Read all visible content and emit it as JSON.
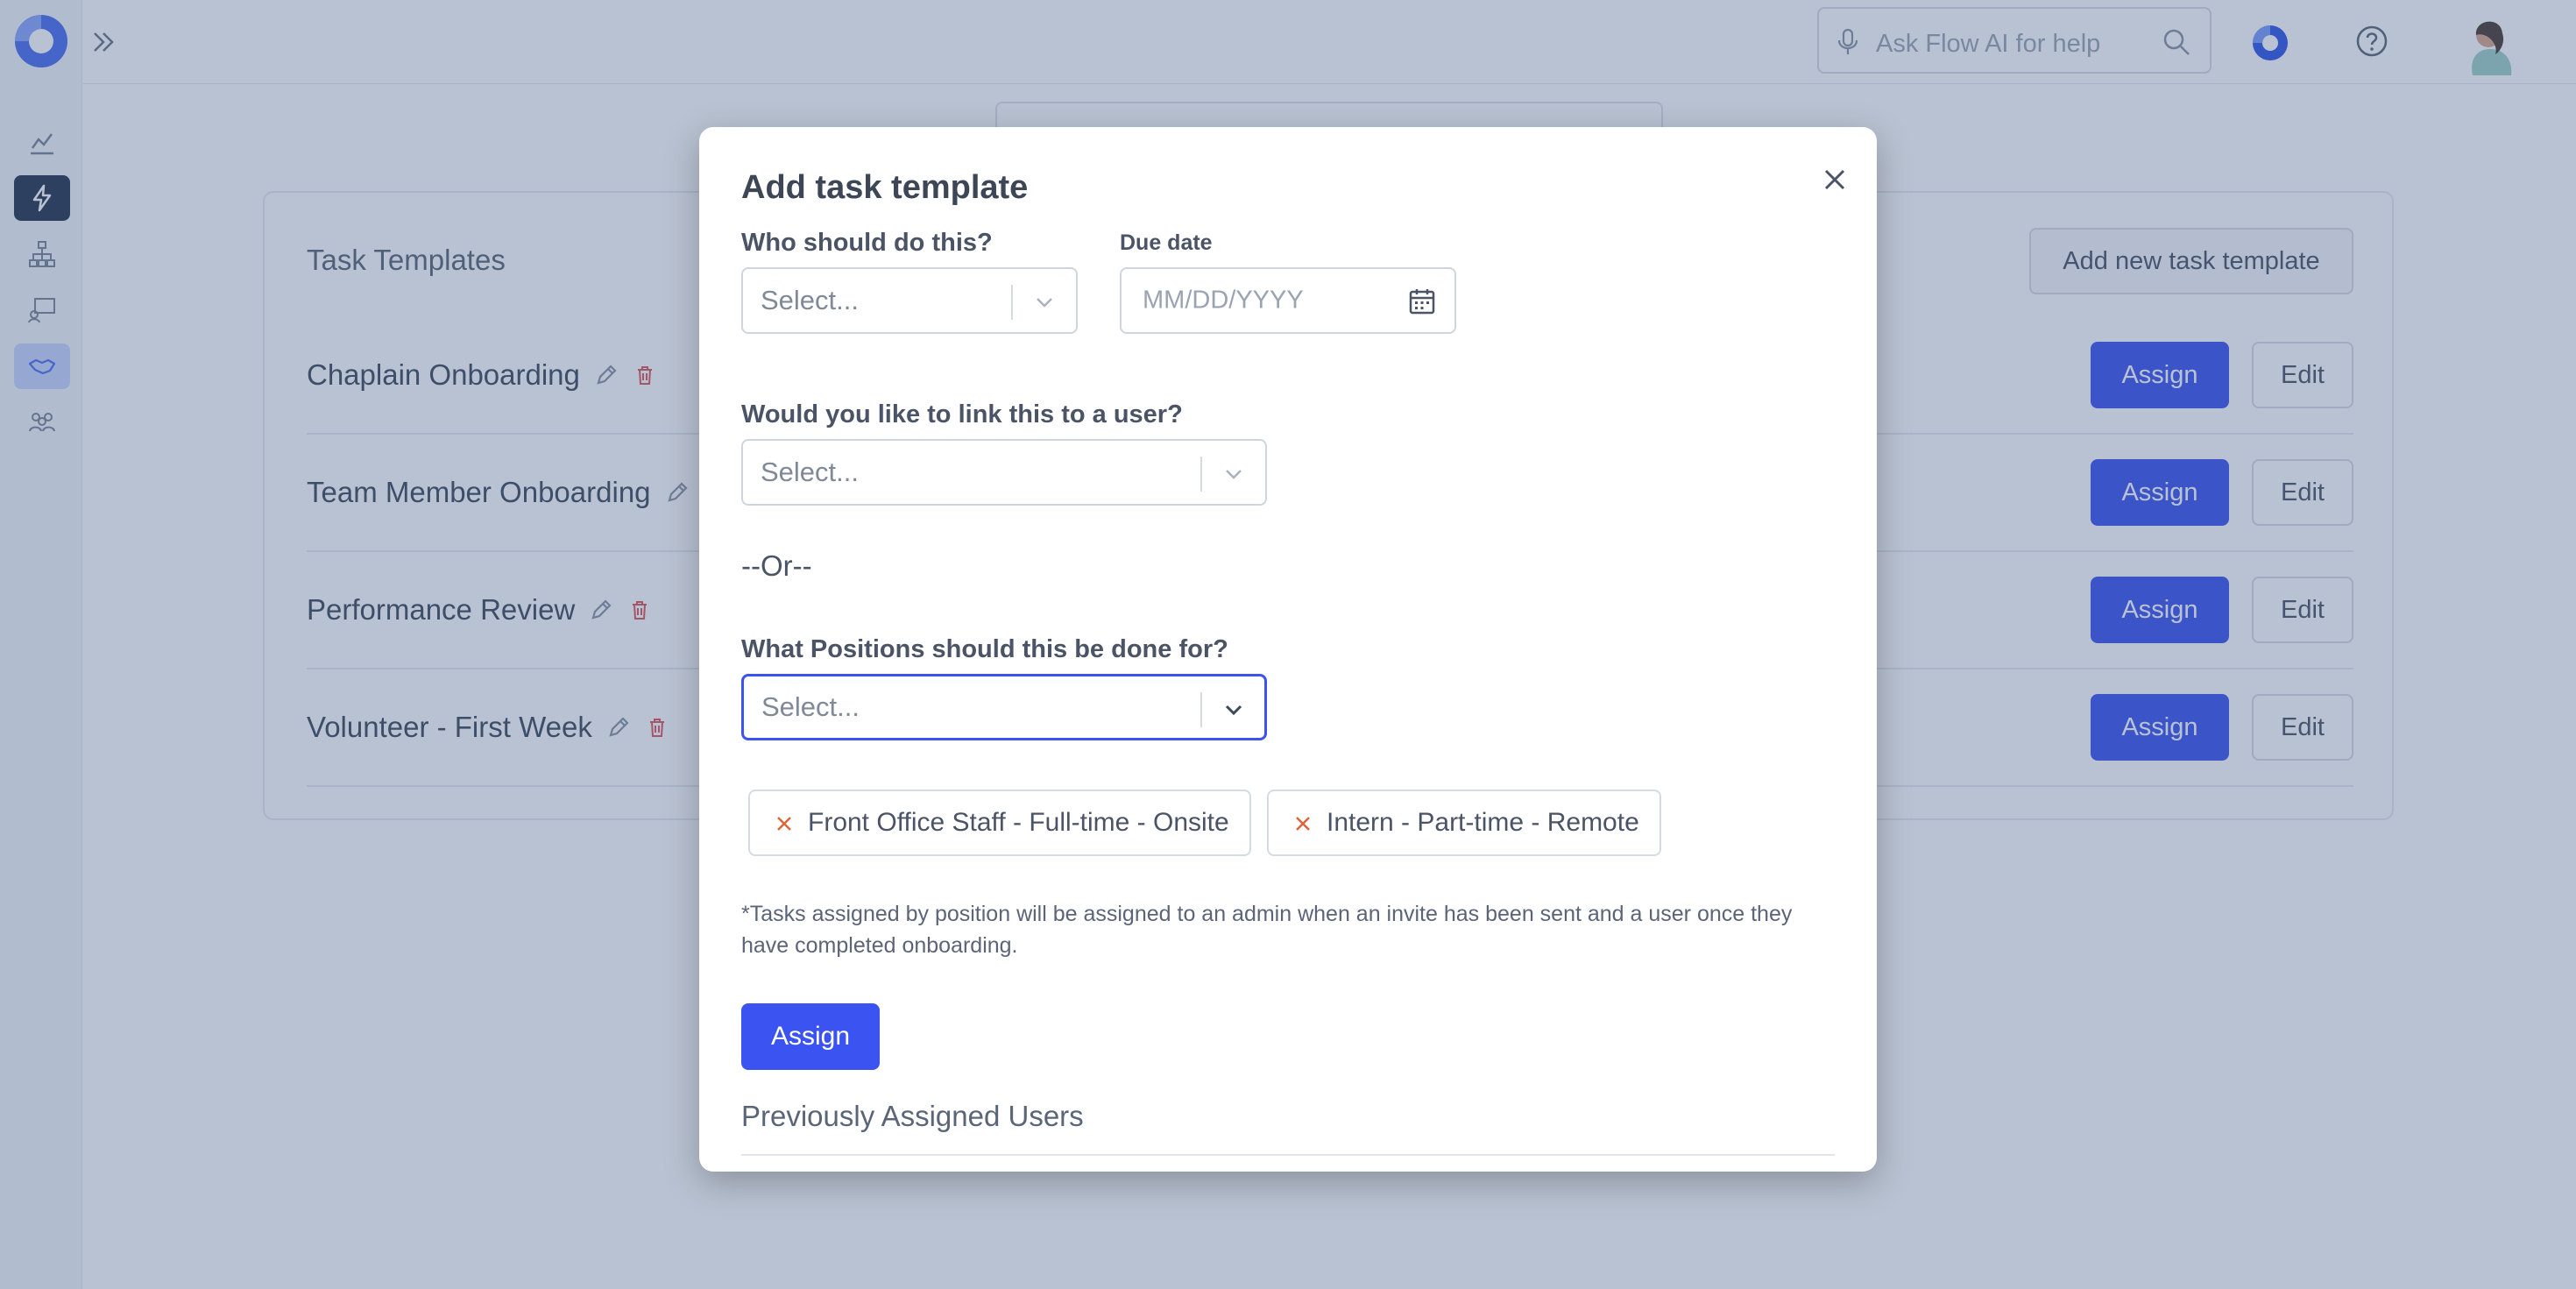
{
  "topbar": {
    "search_placeholder": "Ask Flow AI for help"
  },
  "templates": {
    "title": "Task Templates",
    "add_button": "Add new task template",
    "rows": [
      {
        "name": "Chaplain Onboarding",
        "assign": "Assign",
        "edit": "Edit"
      },
      {
        "name": "Team Member Onboarding",
        "assign": "Assign",
        "edit": "Edit"
      },
      {
        "name": "Performance Review",
        "assign": "Assign",
        "edit": "Edit"
      },
      {
        "name": "Volunteer - First Week",
        "assign": "Assign",
        "edit": "Edit"
      }
    ]
  },
  "modal": {
    "title": "Add task template",
    "who_label": "Who should do this?",
    "who_placeholder": "Select...",
    "due_label": "Due date",
    "due_placeholder": "MM/DD/YYYY",
    "link_user_label": "Would you like to link this to a user?",
    "link_user_placeholder": "Select...",
    "or_text": "--Or--",
    "positions_label": "What Positions should this be done for?",
    "positions_placeholder": "Select...",
    "selected_positions": [
      "Front Office Staff - Full-time - Onsite",
      "Intern - Part-time - Remote"
    ],
    "note": "*Tasks assigned by position will be assigned to an admin when an invite has been sent and a user once they have completed onboarding.",
    "assign_button": "Assign",
    "previous_title": "Previously Assigned Users"
  },
  "colors": {
    "accent": "#3b53f0",
    "overlay": "#3e5682",
    "delete_red": "#e05757",
    "chip_x": "#e0643b"
  }
}
